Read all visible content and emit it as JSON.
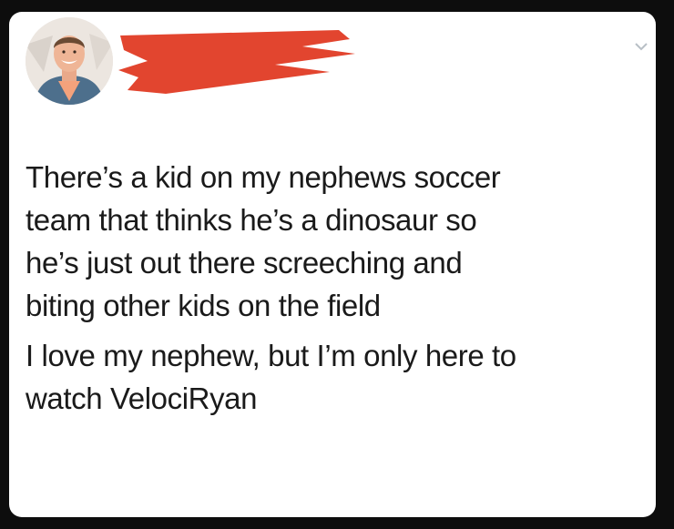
{
  "tweet": {
    "avatar_icon": "profile-photo",
    "chevron_icon": "chevron-down-icon",
    "redaction_color": "#e2452f",
    "paragraphs": [
      "There’s a kid on my nephews soccer\nteam that thinks he’s a dinosaur so\nhe’s just out there screeching and\nbiting other kids on the field",
      "I love my nephew, but I’m only here to\nwatch VelociRyan"
    ]
  }
}
